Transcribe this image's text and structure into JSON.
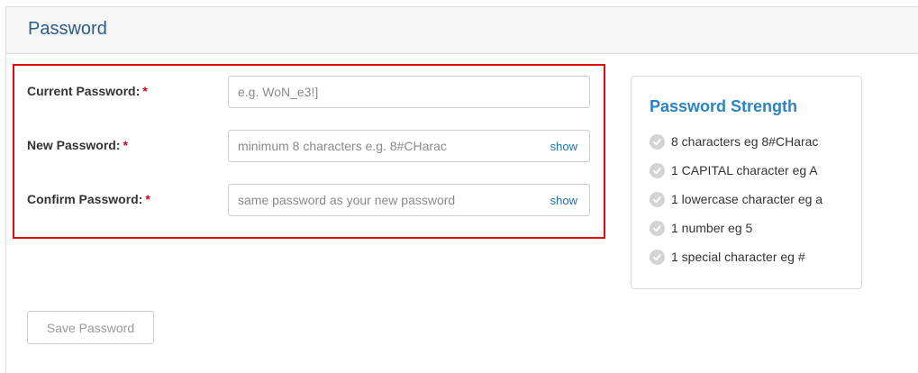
{
  "panel": {
    "title": "Password"
  },
  "form": {
    "current_password": {
      "label": "Current Password:",
      "required_mark": "*",
      "value": "",
      "placeholder": "e.g. WoN_e3!]"
    },
    "new_password": {
      "label": "New Password:",
      "required_mark": "*",
      "value": "",
      "placeholder": "minimum 8 characters e.g. 8#CHarac",
      "show_label": "show"
    },
    "confirm_password": {
      "label": "Confirm Password:",
      "required_mark": "*",
      "value": "",
      "placeholder": "same password as your new password",
      "show_label": "show"
    },
    "save_button": {
      "label": "Save Password",
      "state": "disabled"
    }
  },
  "strength": {
    "title": "Password Strength",
    "rules": [
      {
        "text": "8 characters eg 8#CHarac",
        "icon": "check-circle-icon",
        "met": false
      },
      {
        "text": "1 CAPITAL character eg A",
        "icon": "check-circle-icon",
        "met": false
      },
      {
        "text": "1 lowercase character eg a",
        "icon": "check-circle-icon",
        "met": false
      },
      {
        "text": "1 number eg 5",
        "icon": "check-circle-icon",
        "met": false
      },
      {
        "text": "1 special character eg #",
        "icon": "check-circle-icon",
        "met": false
      }
    ]
  },
  "colors": {
    "title_blue": "#2a5d87",
    "strength_title_blue": "#2a83c2",
    "link_blue": "#1a73b5",
    "required_red": "#d0021b",
    "highlight_red": "#e1090f",
    "check_unmet_gray": "#d3d3d3"
  }
}
